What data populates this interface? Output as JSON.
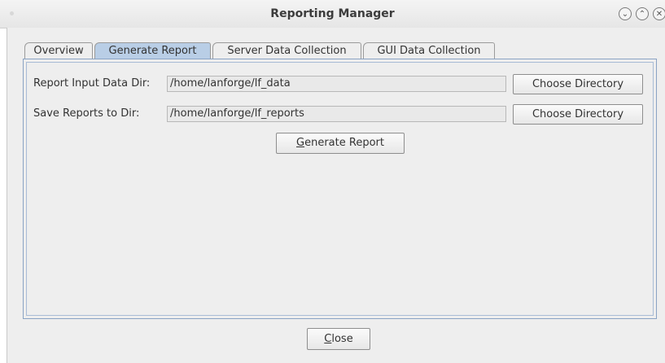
{
  "window": {
    "title": "Reporting Manager",
    "controls": {
      "minimize_icon": "⌄",
      "maximize_icon": "⌃",
      "close_icon": "✕"
    }
  },
  "tabs": [
    {
      "label": "Overview",
      "active": false
    },
    {
      "label": "Generate Report",
      "active": true
    },
    {
      "label": "Server Data Collection",
      "active": false
    },
    {
      "label": "GUI Data Collection",
      "active": false
    }
  ],
  "form": {
    "input_dir_label": "Report Input Data Dir:",
    "input_dir_value": "/home/lanforge/lf_data",
    "save_dir_label": "Save Reports to Dir:",
    "save_dir_value": "/home/lanforge/lf_reports",
    "choose_dir_label": "Choose Directory",
    "generate_mnemonic": "G",
    "generate_rest": "enerate Report"
  },
  "footer": {
    "close_mnemonic": "C",
    "close_rest": "lose"
  },
  "colors": {
    "active_tab": "#b9cee6",
    "panel_border": "#8aa3c4"
  }
}
